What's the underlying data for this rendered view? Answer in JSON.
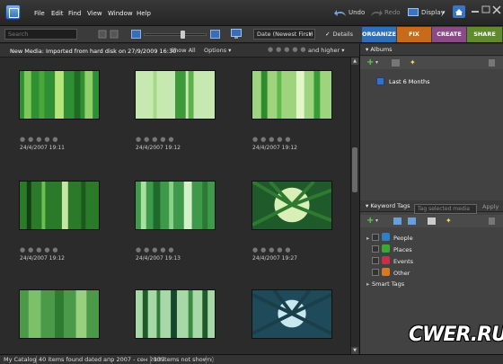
{
  "menu": {
    "items": [
      "File",
      "Edit",
      "Find",
      "View",
      "Window",
      "Help"
    ],
    "undo": "Undo",
    "redo": "Redo",
    "display": "Display"
  },
  "toolbar": {
    "search_placeholder": "Search",
    "sort_value": "Date (Newest First)",
    "details_label": "Details"
  },
  "tabs": [
    {
      "label": "ORGANIZE",
      "color": "#2f6fb7"
    },
    {
      "label": "FIX",
      "color": "#c76a1a"
    },
    {
      "label": "CREATE",
      "color": "#8a4a88"
    },
    {
      "label": "SHARE",
      "color": "#5f8a2e"
    }
  ],
  "subbar": {
    "info": "New Media: Imported from hard disk on 27/9/2009 16:30",
    "show_all": "Show All",
    "options": "Options",
    "and_higher": "and higher"
  },
  "thumbs": [
    {
      "date": "24/4/2007 19:11"
    },
    {
      "date": "24/4/2007 19:12"
    },
    {
      "date": "24/4/2007 19:12"
    },
    {
      "date": "24/4/2007 19:12"
    },
    {
      "date": "24/4/2007 19:13"
    },
    {
      "date": "24/4/2007 19:27"
    },
    {
      "date": ""
    },
    {
      "date": ""
    },
    {
      "date": ""
    }
  ],
  "albums": {
    "title": "Albums",
    "items": [
      "Last 6 Months"
    ]
  },
  "keyword_tags": {
    "title": "Keyword Tags",
    "search_placeholder": "Tag selected media",
    "apply": "Apply",
    "tags": [
      {
        "label": "People",
        "color": "#2e7fc8"
      },
      {
        "label": "Places",
        "color": "#3fa534"
      },
      {
        "label": "Events",
        "color": "#c8304a"
      },
      {
        "label": "Other",
        "color": "#d87a1c"
      }
    ],
    "smart_tags": "Smart Tags"
  },
  "status": {
    "catalog": "My Catalog",
    "found": "40 items found dated апр 2007 - сен 2009",
    "not_shown": "13 items not shown"
  },
  "watermark": "CWER.RU"
}
